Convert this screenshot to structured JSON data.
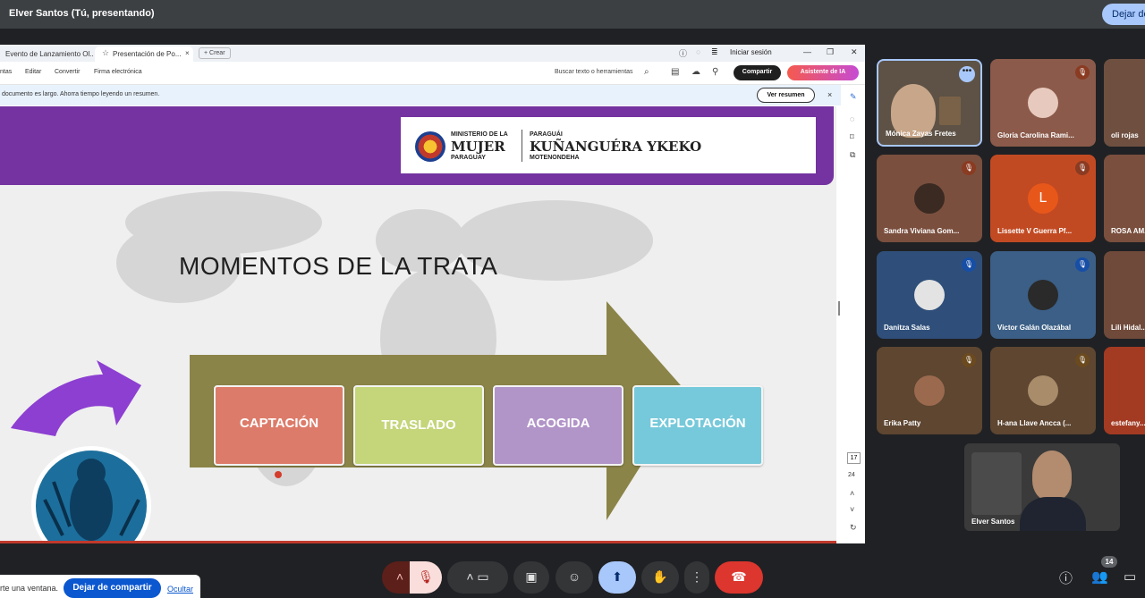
{
  "top_bar": {
    "presenter": "Elver Santos (Tú, presentando)",
    "stop_button": "Dejar de presentar"
  },
  "browser": {
    "tabs": [
      "Evento de Lanzamiento Ol...",
      "Presentación de Po..."
    ],
    "new_tab": "+ Crear",
    "sign_in": "Iniciar sesión",
    "menu": [
      "ntas",
      "Editar",
      "Convertir",
      "Firma electrónica"
    ],
    "search_tools": "Buscar texto o herramientas",
    "share_button": "Compartir",
    "ai_button": "Asistente de IA",
    "notice": "documento es largo. Ahorra tiempo leyendo un resumen.",
    "summary_button": "Ver resumen",
    "page_current": "17",
    "page_total": "24"
  },
  "slide": {
    "logo": {
      "ministry_line1": "MINISTERIO DE LA",
      "ministry_line2": "MUJER",
      "ministry_line3": "PARAGUAY",
      "guarani_line1": "PARAGUÁI",
      "guarani_line2": "KUÑANGUÉRA YKEKO",
      "guarani_line3": "MOTENONDEHA"
    },
    "title": "MOMENTOS DE LA TRATA",
    "steps": [
      "CAPTACIÓN",
      "TRASLADO",
      "ACOGIDA",
      "EXPLOTACIÓN"
    ]
  },
  "participants": [
    {
      "name": "Mónica Zayas Fretes",
      "muted": false
    },
    {
      "name": "Gloria Carolina Rami...",
      "muted": true
    },
    {
      "name": "oli rojas",
      "muted": false
    },
    {
      "name": "Sandra Viviana Gom...",
      "muted": true
    },
    {
      "name": "Lissette V Guerra Pf...",
      "muted": true,
      "initial": "L"
    },
    {
      "name": "ROSA AM...",
      "muted": false
    },
    {
      "name": "Danitza Salas",
      "muted": true
    },
    {
      "name": "Victor Galán Olazábal",
      "muted": true
    },
    {
      "name": "Lili Hidal...",
      "muted": false
    },
    {
      "name": "Erika Patty",
      "muted": true
    },
    {
      "name": "H-ana Llave Ancca (...",
      "muted": true
    },
    {
      "name": "estefany...",
      "muted": false
    }
  ],
  "self_view": {
    "name": "Elver Santos"
  },
  "toast": {
    "text": "rte una ventana.",
    "button": "Dejar de compartir",
    "link": "Ocultar"
  },
  "participant_count": "14",
  "colors": {
    "purple": "#7433a0",
    "olive": "#8b8448",
    "leave_red": "#dc362e",
    "accent_blue": "#a8c7fa"
  }
}
